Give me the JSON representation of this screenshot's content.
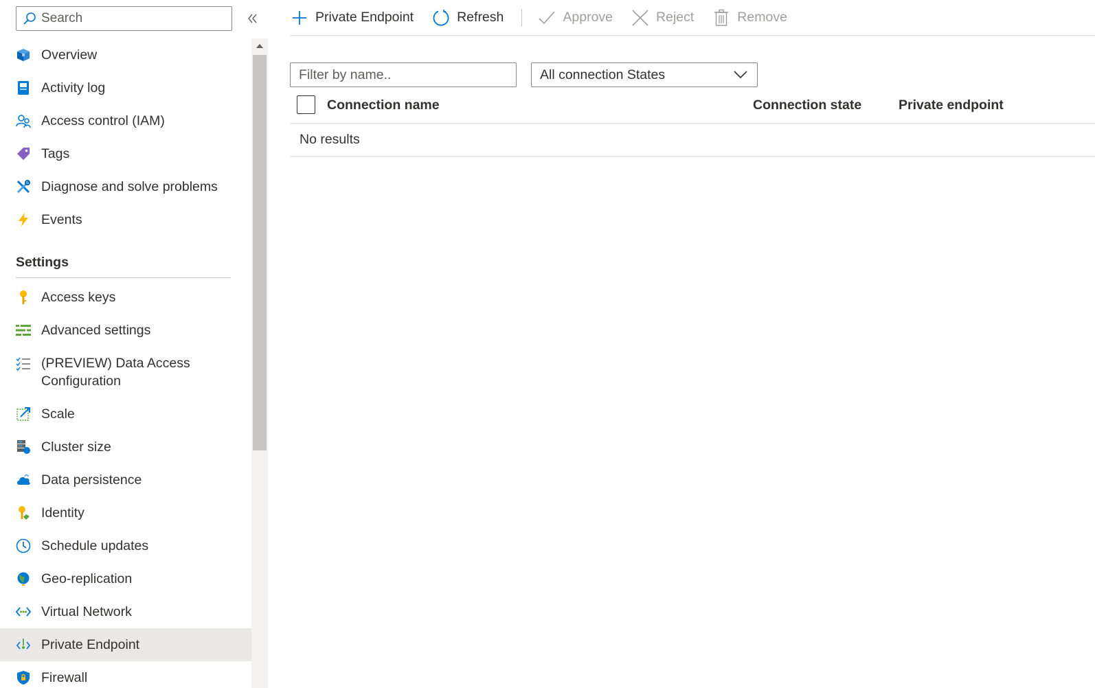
{
  "sidebar": {
    "search_placeholder": "Search",
    "items_top": [
      {
        "label": "Overview",
        "icon": "overview-icon"
      },
      {
        "label": "Activity log",
        "icon": "activity-log-icon"
      },
      {
        "label": "Access control (IAM)",
        "icon": "access-control-icon"
      },
      {
        "label": "Tags",
        "icon": "tag-icon"
      },
      {
        "label": "Diagnose and solve problems",
        "icon": "wrench-icon"
      },
      {
        "label": "Events",
        "icon": "lightning-icon"
      }
    ],
    "settings_header": "Settings",
    "items_settings": [
      {
        "label": "Access keys",
        "icon": "key-icon"
      },
      {
        "label": "Advanced settings",
        "icon": "advanced-settings-icon"
      },
      {
        "label": "(PREVIEW) Data Access Configuration",
        "icon": "checklist-icon"
      },
      {
        "label": "Scale",
        "icon": "scale-icon"
      },
      {
        "label": "Cluster size",
        "icon": "cluster-size-icon"
      },
      {
        "label": "Data persistence",
        "icon": "cloud-icon"
      },
      {
        "label": "Identity",
        "icon": "identity-icon"
      },
      {
        "label": "Schedule updates",
        "icon": "clock-icon"
      },
      {
        "label": "Geo-replication",
        "icon": "globe-icon"
      },
      {
        "label": "Virtual Network",
        "icon": "virtual-network-icon"
      },
      {
        "label": "Private Endpoint",
        "icon": "private-endpoint-icon",
        "active": true
      },
      {
        "label": "Firewall",
        "icon": "shield-icon"
      }
    ]
  },
  "toolbar": {
    "private_endpoint": "Private Endpoint",
    "refresh": "Refresh",
    "approve": "Approve",
    "reject": "Reject",
    "remove": "Remove"
  },
  "filters": {
    "name_placeholder": "Filter by name..",
    "state_selected": "All connection States"
  },
  "table": {
    "columns": [
      "Connection name",
      "Connection state",
      "Private endpoint"
    ],
    "empty_text": "No results"
  },
  "colors": {
    "accent": "#0078d4",
    "disabled": "#a19f9d",
    "active_bg": "#e9e8e7"
  }
}
